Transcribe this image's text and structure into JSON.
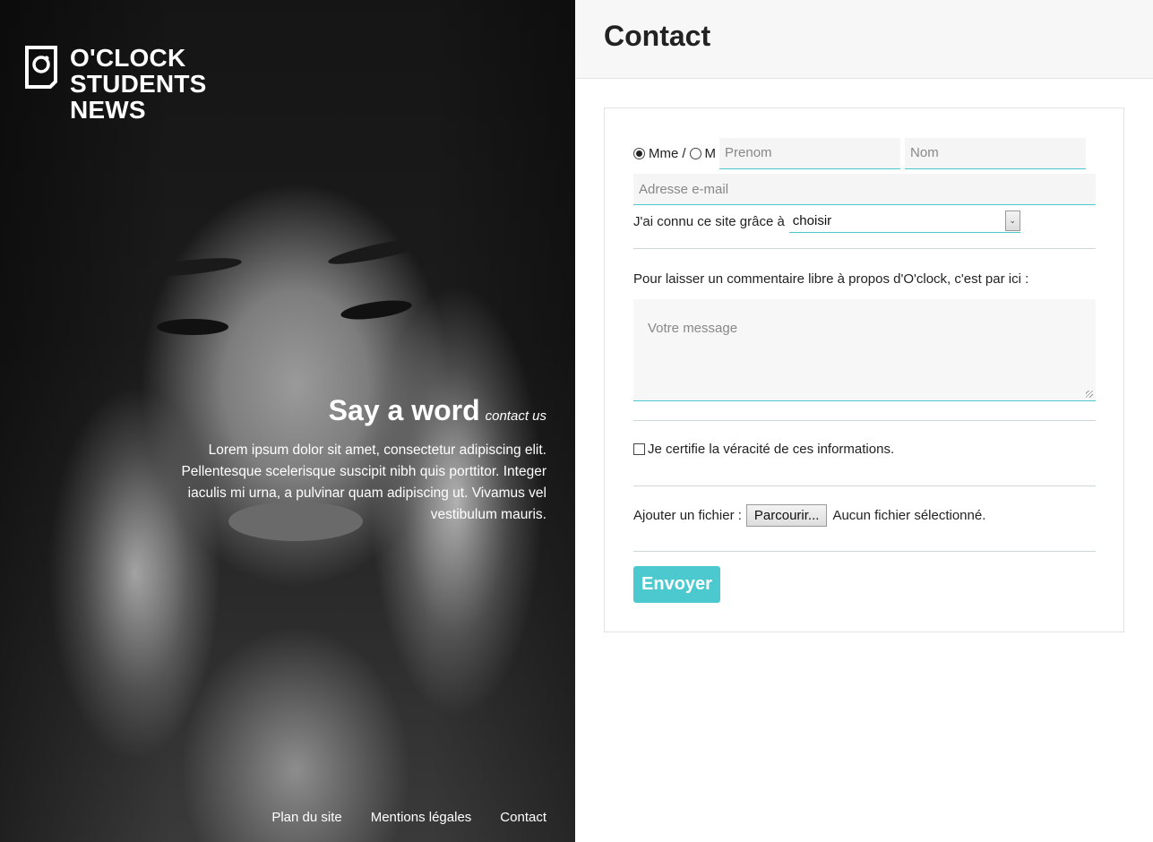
{
  "brand": {
    "lines": [
      "O'CLOCK",
      "STUDENTS",
      "NEWS"
    ]
  },
  "hero": {
    "title": "Say a word",
    "subtitle": "contact us",
    "body": "Lorem ipsum dolor sit amet, consectetur adipiscing elit. Pellentesque scelerisque suscipit nibh quis porttitor. Integer iaculis mi urna, a pulvinar quam adipiscing ut. Vivamus vel vestibulum mauris."
  },
  "footer": {
    "links": [
      "Plan du site",
      "Mentions légales",
      "Contact"
    ]
  },
  "page": {
    "title": "Contact"
  },
  "form": {
    "civility": {
      "options": [
        "Mme",
        "M"
      ],
      "separator": "/",
      "selected": "Mme"
    },
    "firstname_placeholder": "Prenom",
    "lastname_placeholder": "Nom",
    "email_placeholder": "Adresse e-mail",
    "source_label": "J'ai connu ce site grâce à",
    "source_selected": "choisir",
    "comment_label": "Pour laisser un commentaire libre à propos d'O'clock, c'est par ici :",
    "message_placeholder": "Votre message",
    "certify_label": "Je certifie la véracité de ces informations.",
    "file_label": "Ajouter un fichier :",
    "file_button": "Parcourir...",
    "file_status": "Aucun fichier sélectionné.",
    "submit_label": "Envoyer"
  },
  "colors": {
    "accent": "#4cc9cf",
    "header_bg": "#f7f7f7",
    "input_bg": "#f5f5f5"
  },
  "icons": {
    "logo": "camera-instant-icon",
    "select": "chevron-down-icon"
  }
}
